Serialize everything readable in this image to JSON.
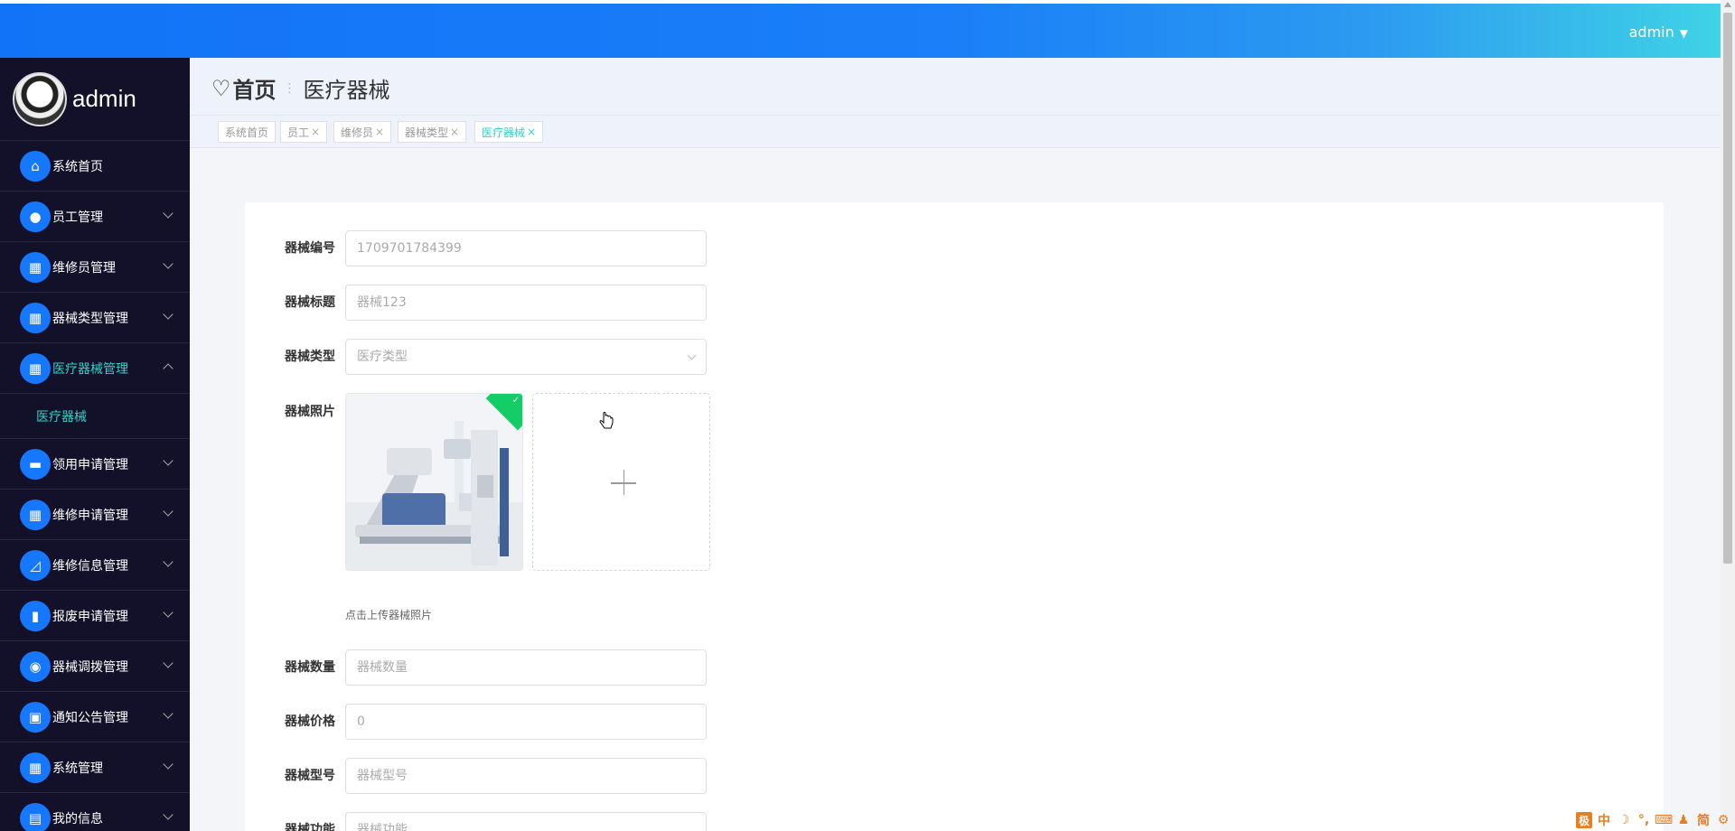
{
  "topbar": {
    "user": "admin"
  },
  "sidebar": {
    "profile_name": "admin",
    "items": [
      {
        "label": "系统首页",
        "icon": "home-icon",
        "glyph": "⌂"
      },
      {
        "label": "员工管理",
        "icon": "lightbulb-icon",
        "glyph": "●"
      },
      {
        "label": "维修员管理",
        "icon": "grid-icon",
        "glyph": "▦"
      },
      {
        "label": "器械类型管理",
        "icon": "grid-icon",
        "glyph": "▦"
      },
      {
        "label": "医疗器械管理",
        "icon": "grid-icon",
        "glyph": "▦"
      },
      {
        "label": "领用申请管理",
        "icon": "ticket-icon",
        "glyph": "▬"
      },
      {
        "label": "维修申请管理",
        "icon": "grid-icon",
        "glyph": "▦"
      },
      {
        "label": "维修信息管理",
        "icon": "chart-icon",
        "glyph": "◿"
      },
      {
        "label": "报废申请管理",
        "icon": "bar-chart-icon",
        "glyph": "▮"
      },
      {
        "label": "器械调拨管理",
        "icon": "user-icon",
        "glyph": "◉"
      },
      {
        "label": "通知公告管理",
        "icon": "notice-icon",
        "glyph": "▣"
      },
      {
        "label": "系统管理",
        "icon": "grid-icon",
        "glyph": "▦"
      },
      {
        "label": "我的信息",
        "icon": "card-icon",
        "glyph": "▤"
      }
    ],
    "submenu": "医疗器械"
  },
  "breadcrumb": {
    "home": "首页",
    "current": "医疗器械"
  },
  "tags": [
    {
      "label": "系统首页",
      "closable": false
    },
    {
      "label": "员工",
      "closable": true
    },
    {
      "label": "维修员",
      "closable": true
    },
    {
      "label": "器械类型",
      "closable": true
    },
    {
      "label": "医疗器械",
      "closable": true,
      "active": true
    }
  ],
  "form": {
    "code": {
      "label": "器械编号",
      "value": "1709701784399"
    },
    "title": {
      "label": "器械标题",
      "value": "器械123"
    },
    "type": {
      "label": "器械类型",
      "placeholder": "医疗类型"
    },
    "photo": {
      "label": "器械照片",
      "hint": "点击上传器械照片"
    },
    "count": {
      "label": "器械数量",
      "placeholder": "器械数量"
    },
    "price": {
      "label": "器械价格",
      "value": "0"
    },
    "model": {
      "label": "器械型号",
      "placeholder": "器械型号"
    },
    "func": {
      "label": "器械功能",
      "placeholder": "器械功能"
    }
  },
  "ime": [
    "极",
    "中",
    "☽",
    "°,",
    "⌨",
    "♟",
    "简",
    "⚙"
  ]
}
